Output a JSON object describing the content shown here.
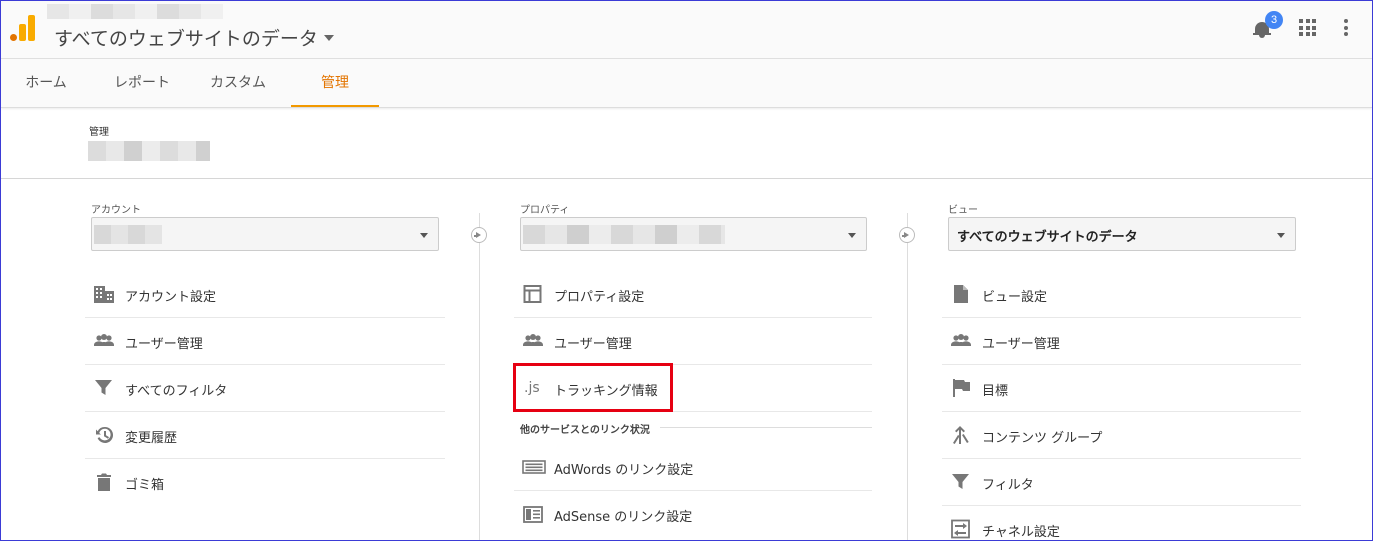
{
  "header": {
    "view_title": "すべてのウェブサイトのデータ",
    "notification_count": "3"
  },
  "tabs": [
    {
      "label": "ホーム"
    },
    {
      "label": "レポート"
    },
    {
      "label": "カスタム"
    },
    {
      "label": "管理"
    }
  ],
  "admin": {
    "label": "管理"
  },
  "account": {
    "label": "アカウント",
    "items": [
      {
        "label": "アカウント設定",
        "icon": "building-icon"
      },
      {
        "label": "ユーザー管理",
        "icon": "users-icon"
      },
      {
        "label": "すべてのフィルタ",
        "icon": "filter-icon"
      },
      {
        "label": "変更履歴",
        "icon": "history-icon"
      },
      {
        "label": "ゴミ箱",
        "icon": "trash-icon"
      }
    ]
  },
  "property": {
    "label": "プロパティ",
    "items": [
      {
        "label": "プロパティ設定",
        "icon": "property-icon"
      },
      {
        "label": "ユーザー管理",
        "icon": "users-icon"
      },
      {
        "label": "トラッキング情報",
        "icon": "js-icon"
      }
    ],
    "section_title": "他のサービスとのリンク状況",
    "link_items": [
      {
        "label": "AdWords のリンク設定",
        "icon": "adwords-icon"
      },
      {
        "label": "AdSense のリンク設定",
        "icon": "adsense-icon"
      }
    ]
  },
  "view": {
    "label": "ビュー",
    "selected": "すべてのウェブサイトのデータ",
    "items": [
      {
        "label": "ビュー設定",
        "icon": "document-icon"
      },
      {
        "label": "ユーザー管理",
        "icon": "users-icon"
      },
      {
        "label": "目標",
        "icon": "flag-icon"
      },
      {
        "label": "コンテンツ グループ",
        "icon": "content-group-icon"
      },
      {
        "label": "フィルタ",
        "icon": "filter-icon"
      },
      {
        "label": "チャネル設定",
        "icon": "channel-icon"
      }
    ]
  },
  "colors": {
    "accent": "#f29900",
    "highlight_box": "#e60012",
    "badge": "#4285f4"
  }
}
